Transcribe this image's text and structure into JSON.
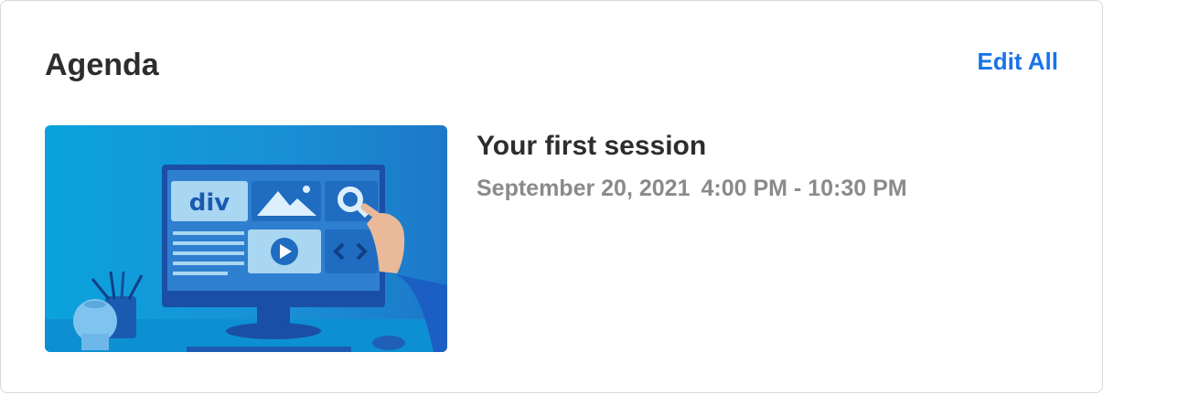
{
  "agenda": {
    "title": "Agenda",
    "edit_all_label": "Edit All"
  },
  "sessions": [
    {
      "title": "Your first session",
      "date": "September 20, 2021",
      "time": "4:00 PM - 10:30 PM",
      "thumbnail": {
        "monitor_text": "div",
        "icons": [
          "image-icon",
          "search-icon",
          "play-icon",
          "code-icon"
        ]
      }
    }
  ]
}
